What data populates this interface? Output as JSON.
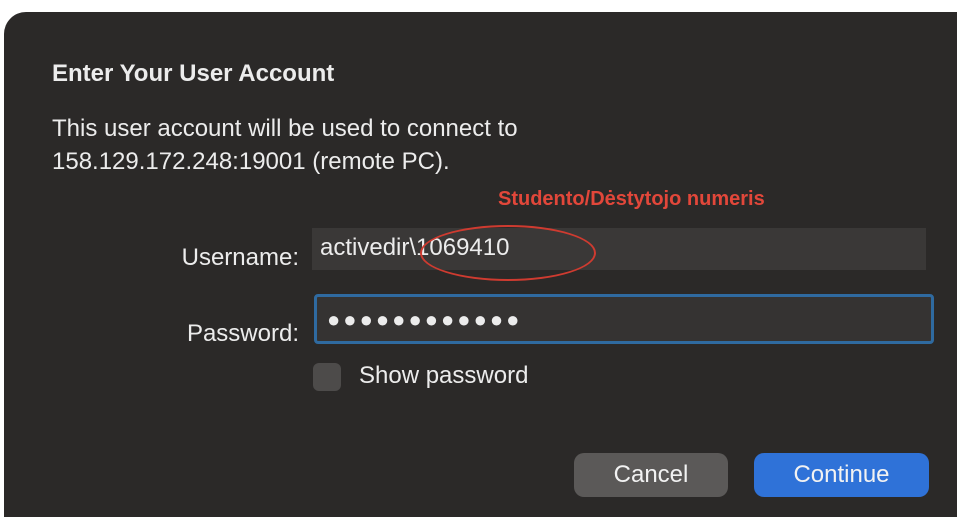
{
  "dialog": {
    "title": "Enter Your User Account",
    "message_line1": "This user account will be used to connect to",
    "message_line2": "158.129.172.248:19001 (remote PC).",
    "annotation": "Studento/Dėstytojo numeris",
    "username_label": "Username:",
    "username_value": "activedir\\1069410",
    "password_label": "Password:",
    "password_masked": "●●●●●●●●●●●●",
    "show_password_label": "Show password",
    "show_password_checked": false,
    "cancel_label": "Cancel",
    "continue_label": "Continue"
  },
  "colors": {
    "dialog_background": "#2b2928",
    "accent_button": "#2f72d8",
    "focus_ring": "#2f6aa0",
    "annotation": "#e2473a"
  }
}
